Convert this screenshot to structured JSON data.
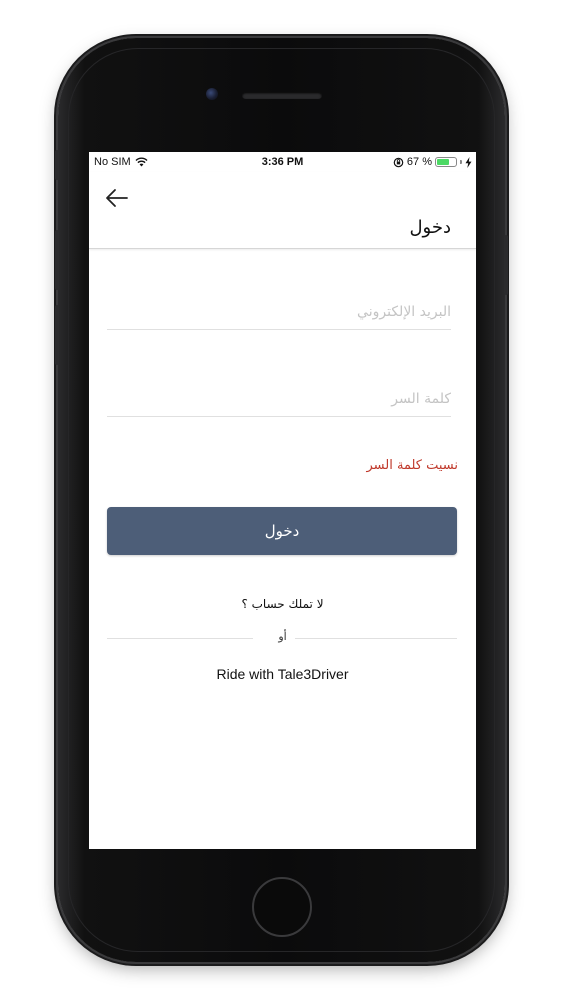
{
  "status_bar": {
    "carrier": "No SIM",
    "time": "3:36 PM",
    "battery_percent": "67 %",
    "battery_level": 0.67
  },
  "header": {
    "title": "دخول",
    "back_icon": "arrow-left-icon"
  },
  "form": {
    "email_placeholder": "البريد الإلكتروني",
    "password_placeholder": "كلمة السر",
    "forgot_password": "نسيت كلمة السر",
    "login_button": "دخول"
  },
  "footer": {
    "no_account": "لا تملك حساب ؟",
    "or": "أو",
    "ride_link": "Ride with Tale3Driver"
  },
  "colors": {
    "primary_button": "#4d5e78",
    "forgot_link": "#c0392b",
    "battery": "#4cd964"
  }
}
